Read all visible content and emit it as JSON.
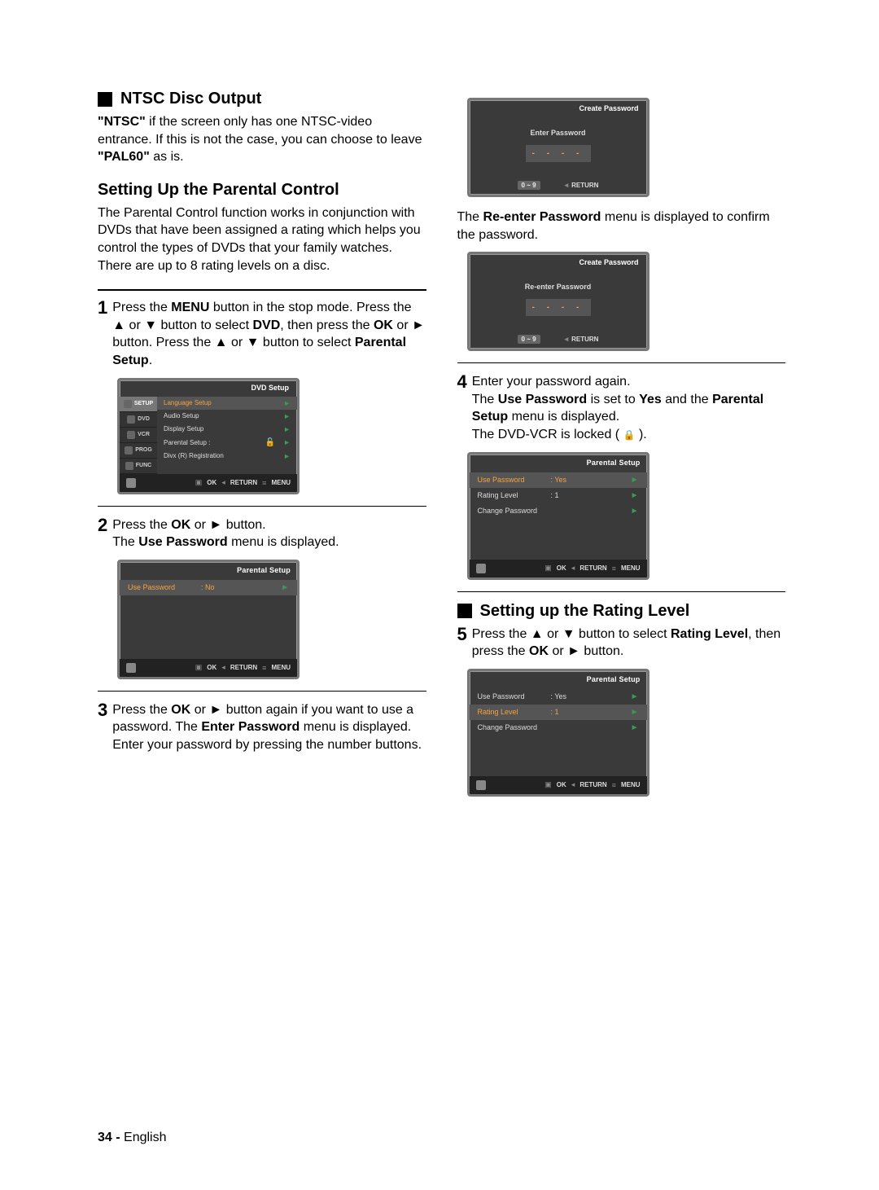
{
  "left": {
    "ntsc": {
      "title": "NTSC Disc Output",
      "p1a": "\"NTSC\"",
      "p1b": " if the screen only has one NTSC-video entrance. If this is not the case, you can choose to leave ",
      "p1c": "\"PAL60\"",
      "p1d": " as is."
    },
    "parental": {
      "title": "Setting Up the Parental Control",
      "para": "The Parental Control function works in conjunction with DVDs that have been assigned a rating which helps you control the types of DVDs that your family watches. There are up to 8 rating levels on a disc."
    },
    "step1": {
      "num": "1",
      "a": "Press the ",
      "menu": "MENU",
      "b": " button in the stop mode. Press the ",
      "c": " or ",
      "d": " button to select ",
      "dvd": "DVD",
      "e": ", then press the ",
      "ok": "OK",
      "f": " or ",
      "g": " button. Press the ",
      "h": " or ",
      "i": " button to select ",
      "ps": "Parental Setup",
      "j": "."
    },
    "step2": {
      "num": "2",
      "a": "Press the ",
      "ok": "OK",
      "b": " or ",
      "c": " button.",
      "d": "The ",
      "up": "Use Password",
      "e": " menu is displayed."
    },
    "step3": {
      "num": "3",
      "a": "Press  the ",
      "ok": "OK",
      "b": " or ",
      "c": " button again if you want to use a password. The ",
      "ep": "Enter Password",
      "d": " menu is displayed. Enter your password by pressing the number buttons."
    },
    "osd1": {
      "title": "DVD  Setup",
      "tabs": [
        "SETUP",
        "DVD",
        "VCR",
        "PROG",
        "FUNC"
      ],
      "items": [
        {
          "t": "Language Setup",
          "sel": true
        },
        {
          "t": "Audio Setup"
        },
        {
          "t": "Display Setup"
        },
        {
          "t": "Parental Setup :",
          "lock": true
        },
        {
          "t": "Divx (R) Registration"
        }
      ],
      "foot": {
        "ok": "OK",
        "ret": "RETURN",
        "menu": "MENU"
      }
    },
    "osd2": {
      "title": "Parental Setup",
      "row": {
        "label": "Use Password",
        "val": ": No"
      },
      "foot": {
        "ok": "OK",
        "ret": "RETURN",
        "menu": "MENU"
      }
    }
  },
  "right": {
    "osd3": {
      "title": "Create Password",
      "msg": "Enter Password",
      "dashes": "-  -  -  -",
      "foot": {
        "range": "0 ~ 9",
        "ret": "RETURN"
      }
    },
    "line1a": "The ",
    "line1b": "Re-enter Password",
    "line1c": " menu is displayed to confirm the password.",
    "osd4": {
      "title": "Create Password",
      "msg": "Re-enter Password",
      "dashes": "-  -  -  -",
      "foot": {
        "range": "0 ~ 9",
        "ret": "RETURN"
      }
    },
    "step4": {
      "num": "4",
      "a": "Enter your password again.",
      "b": "The ",
      "up": "Use Password",
      "c": " is set to ",
      "yes": "Yes",
      "d": " and the ",
      "ps": "Parental Setup",
      "e": " menu is displayed.",
      "f": "The DVD-VCR is locked ( ",
      "g": " )."
    },
    "osd5": {
      "title": "Parental  Setup",
      "rows": [
        {
          "label": "Use Password",
          "val": ": Yes",
          "sel": true
        },
        {
          "label": "Rating Level",
          "val": ": 1"
        },
        {
          "label": "Change Password",
          "val": ""
        }
      ],
      "foot": {
        "ok": "OK",
        "ret": "RETURN",
        "menu": "MENU"
      }
    },
    "rating": {
      "title": "Setting up the Rating Level"
    },
    "step5": {
      "num": "5",
      "a": "Press the ",
      "b": " or ",
      "c": " button to select ",
      "rl": "Rating Level",
      "d": ", then press the ",
      "ok": "OK",
      "e": " or ",
      "f": " button."
    },
    "osd6": {
      "title": "Parental  Setup",
      "rows": [
        {
          "label": "Use Password",
          "val": ": Yes"
        },
        {
          "label": "Rating Level",
          "val": ": 1",
          "sel": true
        },
        {
          "label": "Change Password",
          "val": ""
        }
      ],
      "foot": {
        "ok": "OK",
        "ret": "RETURN",
        "menu": "MENU"
      }
    }
  },
  "footer": {
    "page": "34 -",
    "lang": "English"
  }
}
